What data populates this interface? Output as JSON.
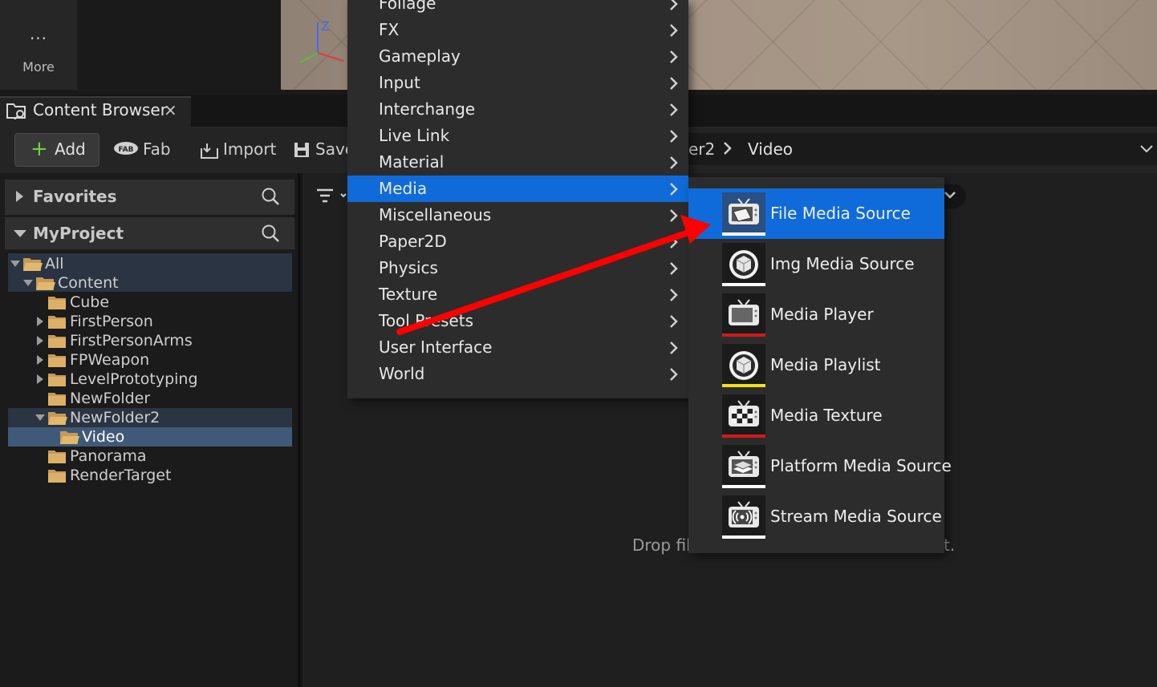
{
  "top": {
    "more_label": "More",
    "more_icon": "ellipsis-icon",
    "gizmo_axis_z": "Z"
  },
  "content_browser": {
    "tab_title": "Content Browser",
    "tab_close": "×",
    "toolbar": {
      "add_label": "Add",
      "fab_label": "Fab",
      "import_label": "Import",
      "save_label": "Save"
    },
    "breadcrumb": {
      "parent_fragment": "er2",
      "current": "Video"
    },
    "panels": {
      "favorites": "Favorites",
      "project": "MyProject"
    },
    "tree": [
      {
        "label": "All",
        "expanded": true
      },
      {
        "label": "Content",
        "expanded": true
      },
      {
        "label": "Cube"
      },
      {
        "label": "FirstPerson"
      },
      {
        "label": "FirstPersonArms"
      },
      {
        "label": "FPWeapon"
      },
      {
        "label": "LevelPrototyping"
      },
      {
        "label": "NewFolder"
      },
      {
        "label": "NewFolder2",
        "expanded": true
      },
      {
        "label": "Video",
        "selected": true
      },
      {
        "label": "Panorama"
      },
      {
        "label": "RenderTarget"
      }
    ],
    "drop_hint_start": "Drop file",
    "drop_hint_end": "t."
  },
  "menu": {
    "items": [
      "Foliage",
      "FX",
      "Gameplay",
      "Input",
      "Interchange",
      "Live Link",
      "Material",
      "Media",
      "Miscellaneous",
      "Paper2D",
      "Physics",
      "Texture",
      "Tool Presets",
      "User Interface",
      "World"
    ],
    "highlighted": "Media"
  },
  "submenu": {
    "items": [
      {
        "label": "File Media Source",
        "bar_color": "#ffffff",
        "icon": "tv-file-icon"
      },
      {
        "label": "Img Media Source",
        "bar_color": "#ffffff",
        "icon": "cube-sphere-icon"
      },
      {
        "label": "Media Player",
        "bar_color": "#d11a1a",
        "icon": "tv-icon"
      },
      {
        "label": "Media Playlist",
        "bar_color": "#f2e01b",
        "icon": "cube-sphere-icon"
      },
      {
        "label": "Media Texture",
        "bar_color": "#d11a1a",
        "icon": "tv-checker-icon"
      },
      {
        "label": "Platform Media Source",
        "bar_color": "#ffffff",
        "icon": "tv-stack-icon"
      },
      {
        "label": "Stream Media Source",
        "bar_color": "#ffffff",
        "icon": "tv-stream-icon"
      }
    ],
    "highlighted": "File Media Source"
  },
  "colors": {
    "highlight": "#0f6bd9",
    "annotation_arrow": "#ff0000",
    "add_plus": "#6fd24c"
  }
}
